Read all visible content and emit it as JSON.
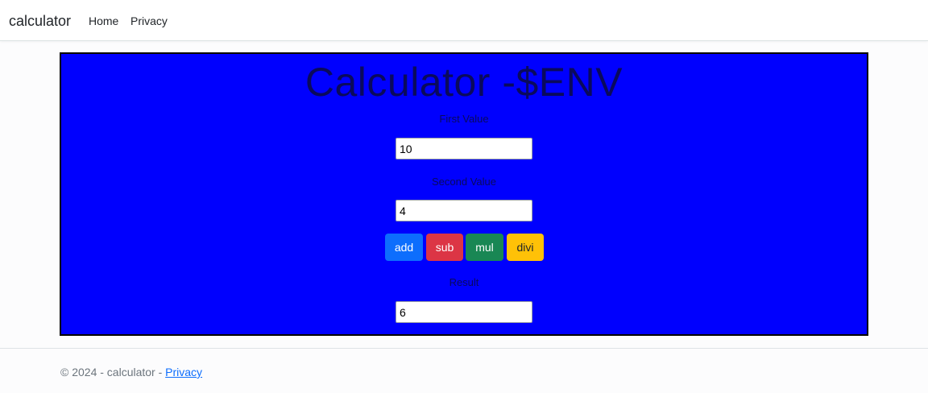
{
  "navbar": {
    "brand": "calculator",
    "links": [
      {
        "label": "Home"
      },
      {
        "label": "Privacy"
      }
    ]
  },
  "calculator": {
    "title": "Calculator -$ENV",
    "background_color": "#0000fe",
    "first_label": "First Value",
    "first_value": "10",
    "second_label": "Second Value",
    "second_value": "4",
    "buttons": [
      {
        "label": "add",
        "color": "#0d6efd"
      },
      {
        "label": "sub",
        "color": "#dc3545"
      },
      {
        "label": "mul",
        "color": "#198754"
      },
      {
        "label": "divi",
        "color": "#ffc107"
      }
    ],
    "result_label": "Result",
    "result_value": "6"
  },
  "footer": {
    "text": "© 2024 - calculator - ",
    "link_label": "Privacy"
  }
}
